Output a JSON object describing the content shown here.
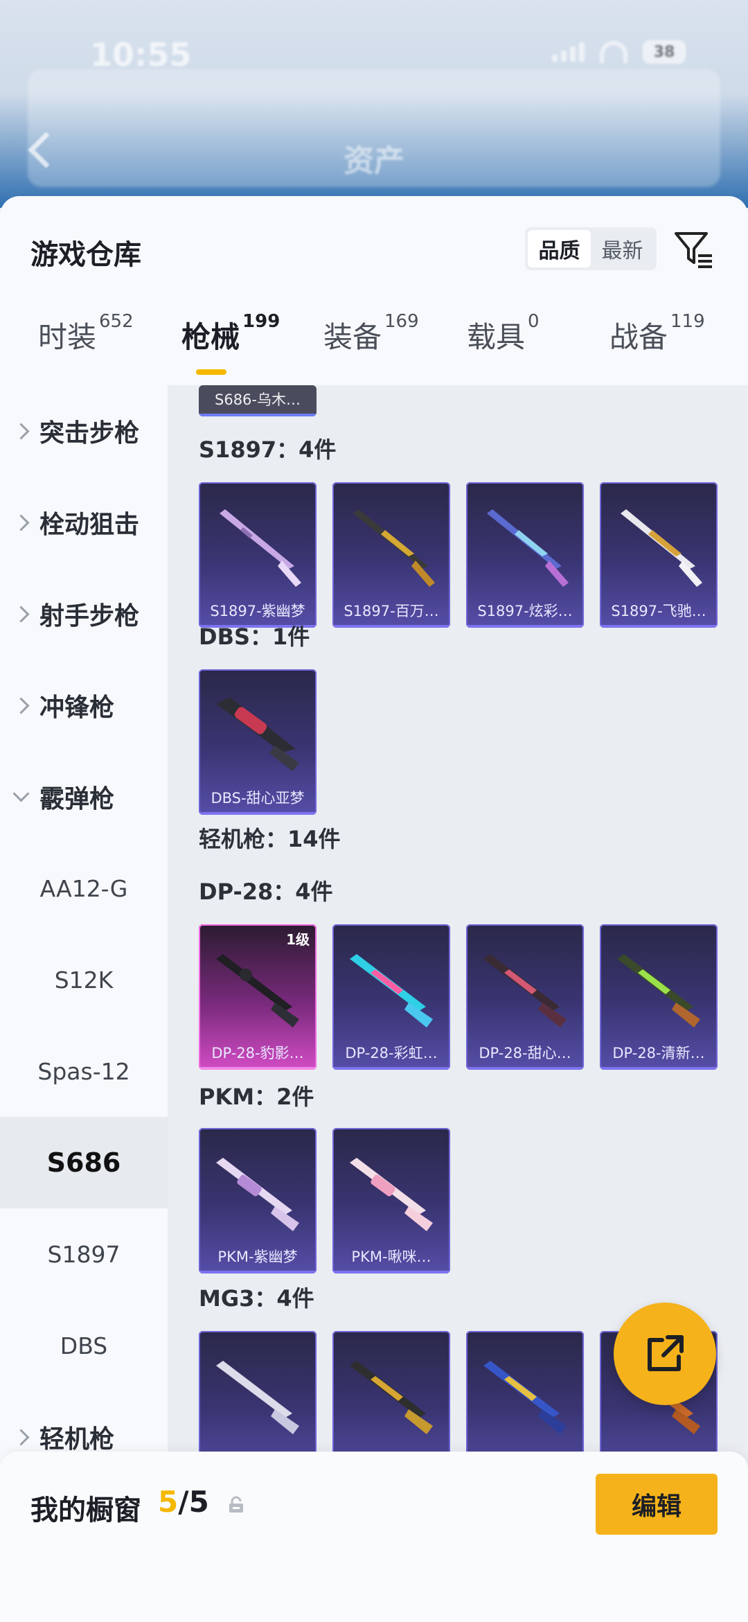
{
  "status": {
    "time": "10:55",
    "battery": "38"
  },
  "header": {
    "title": "资产"
  },
  "sheet": {
    "title": "游戏仓库",
    "sort": {
      "quality": "品质",
      "latest": "最新"
    }
  },
  "tabs": [
    {
      "label": "时装",
      "count": "652"
    },
    {
      "label": "枪械",
      "count": "199"
    },
    {
      "label": "装备",
      "count": "169"
    },
    {
      "label": "载具",
      "count": "0"
    },
    {
      "label": "战备",
      "count": "119"
    }
  ],
  "categories": {
    "assault": "突击步枪",
    "bolt": "栓动狙击",
    "marksman": "射手步枪",
    "smg": "冲锋枪",
    "shotgun": "霰弹枪",
    "shotgun_subs": [
      "AA12-G",
      "S12K",
      "Spas-12",
      "S686",
      "S1897",
      "DBS"
    ],
    "lmg": "轻机枪"
  },
  "content": {
    "top_stub": "S686-乌木…",
    "s1897_title": "S1897：4件",
    "s1897_items": [
      "S1897-紫幽梦",
      "S1897-百万…",
      "S1897-炫彩…",
      "S1897-飞驰…"
    ],
    "dbs_title": "DBS：1件",
    "dbs_items": [
      "DBS-甜心亚梦"
    ],
    "lmg_title": "轻机枪：14件",
    "dp28_title": "DP-28：4件",
    "dp28_level": "1级",
    "dp28_items": [
      "DP-28-豹影…",
      "DP-28-彩虹…",
      "DP-28-甜心…",
      "DP-28-清新…"
    ],
    "pkm_title": "PKM：2件",
    "pkm_items": [
      "PKM-紫幽梦",
      "PKM-啾咪…"
    ],
    "mg3_title": "MG3：4件"
  },
  "showcase": {
    "label": "我的橱窗",
    "current": "5",
    "total": "/5",
    "edit": "编辑"
  },
  "colors": {
    "accent": "#f5b21a",
    "card_purple": "#3a3573",
    "card_pink": "#d24cc4"
  },
  "icons": [
    "back-arrow-icon",
    "filter-icon",
    "chevron-right-icon",
    "chevron-down-icon",
    "rifle-icon",
    "share-icon",
    "lock-icon"
  ]
}
